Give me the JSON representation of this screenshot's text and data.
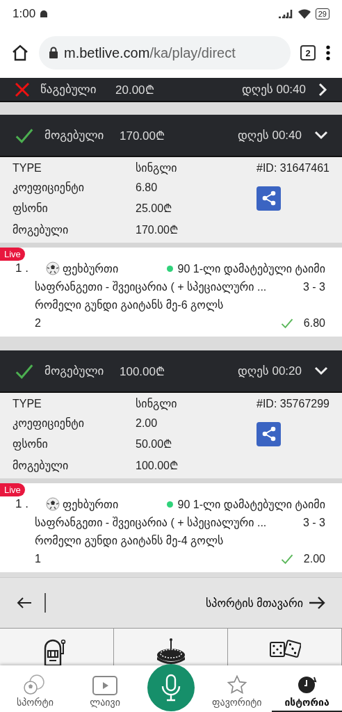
{
  "status_bar": {
    "time": "1:00",
    "battery": "29"
  },
  "browser": {
    "url_host": "m.betlive.com",
    "url_path": "/ka/play/direct",
    "tab_count": "2"
  },
  "bets": [
    {
      "won": false,
      "status_label": "წაგებული",
      "amount": "20.00₾",
      "time": "დღეს 00:40",
      "expanded": false
    },
    {
      "won": true,
      "status_label": "მოგებული",
      "amount": "170.00₾",
      "time": "დღეს 00:40",
      "expanded": true,
      "details": {
        "type_label": "TYPE",
        "type_value": "სინგლი",
        "id": "#ID: 31647461",
        "rows": [
          {
            "label": "კოეფიციენტი",
            "value": "6.80"
          },
          {
            "label": "ფსონი",
            "value": "25.00₾"
          },
          {
            "label": "მოგებული",
            "value": "170.00₾"
          }
        ]
      },
      "events": [
        {
          "live": "Live",
          "index": "1 .",
          "sport": "ფეხბურთი",
          "period": "90 1-ლი დამატებული ტაიმი",
          "match": "საფრანგეთი - შვეიცარია ( + სპეციალური ...",
          "score": "3 - 3",
          "market": "რომელი გუნდი გაიტანს მე-6 გოლს",
          "pick": "2",
          "won": true,
          "odds": "6.80"
        }
      ]
    },
    {
      "won": true,
      "status_label": "მოგებული",
      "amount": "100.00₾",
      "time": "დღეს 00:20",
      "expanded": true,
      "details": {
        "type_label": "TYPE",
        "type_value": "სინგლი",
        "id": "#ID: 35767299",
        "rows": [
          {
            "label": "კოეფიციენტი",
            "value": "2.00"
          },
          {
            "label": "ფსონი",
            "value": "50.00₾"
          },
          {
            "label": "მოგებული",
            "value": "100.00₾"
          }
        ]
      },
      "events": [
        {
          "live": "Live",
          "index": "1 .",
          "sport": "ფეხბურთი",
          "period": "90 1-ლი დამატებული ტაიმი",
          "match": "საფრანგეთი - შვეიცარია ( + სპეციალური ...",
          "score": "3 - 3",
          "market": "რომელი გუნდი გაიტანს მე-4 გოლს",
          "pick": "1",
          "won": true,
          "odds": "2.00"
        }
      ]
    }
  ],
  "pager": {
    "next_label": "სპორტის მთავარი"
  },
  "casino_tiles": [
    {
      "kind": "slot"
    },
    {
      "kind": "roulette"
    },
    {
      "kind": "dice"
    }
  ],
  "bottom_nav": [
    {
      "kind": "sports",
      "label": "სპორტი",
      "selected": false
    },
    {
      "kind": "live",
      "label": "ლაივი",
      "selected": false
    },
    {
      "kind": "mic",
      "selected": false
    },
    {
      "kind": "favorites",
      "label": "ფავორიტი",
      "selected": false
    },
    {
      "kind": "history",
      "label": "ისტორია",
      "selected": true
    }
  ]
}
